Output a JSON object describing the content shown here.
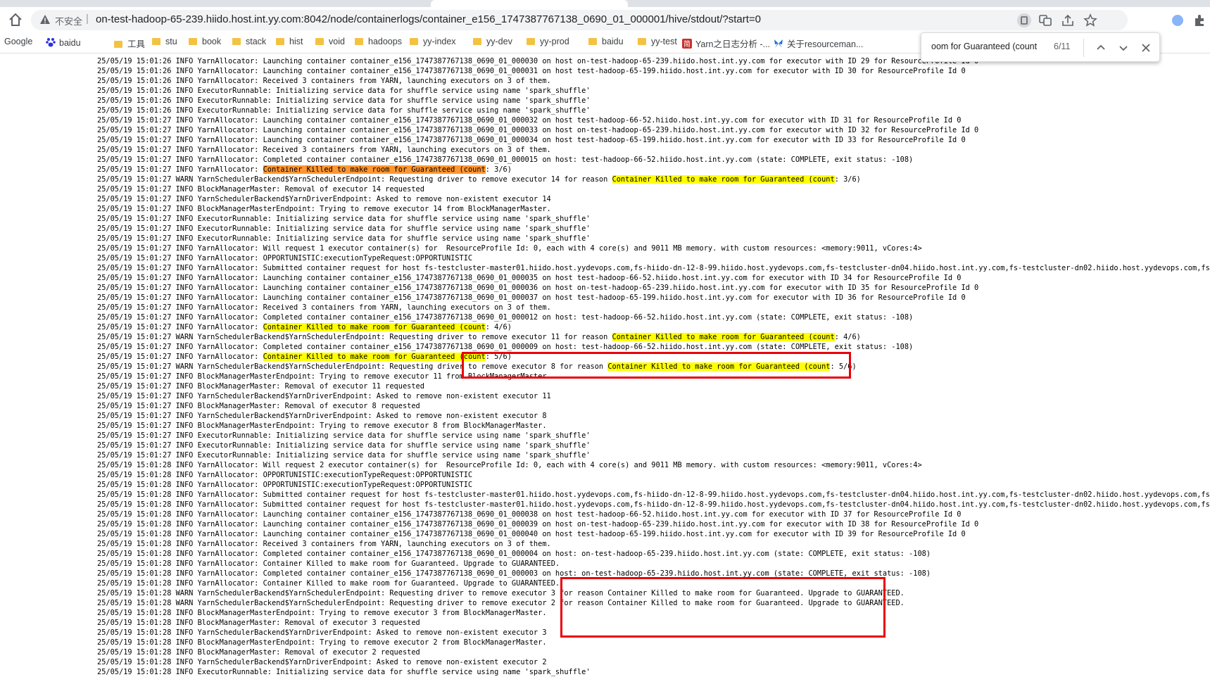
{
  "browser": {
    "insecure_label": "不安全",
    "url": "on-test-hadoop-65-239.hiido.host.int.yy.com:8042/node/containerlogs/container_e156_1747387767138_0690_01_000001/hive/stdout/?start=0",
    "icons": [
      "home-icon",
      "warning-icon",
      "translate-icon",
      "share-icon",
      "star-icon",
      "profile-icon",
      "puzzle-icon"
    ]
  },
  "bookmarks": [
    {
      "label": "Google",
      "icon": "google-icon"
    },
    {
      "label": "baidu",
      "icon": "baidu-paw-icon"
    },
    {
      "label": "工具",
      "icon": "folder-icon"
    },
    {
      "label": "stu",
      "icon": "folder-icon"
    },
    {
      "label": "book",
      "icon": "folder-icon"
    },
    {
      "label": "stack",
      "icon": "folder-icon"
    },
    {
      "label": "hist",
      "icon": "folder-icon"
    },
    {
      "label": "void",
      "icon": "folder-icon"
    },
    {
      "label": "hadoops",
      "icon": "folder-icon"
    },
    {
      "label": "yy-index",
      "icon": "folder-icon"
    },
    {
      "label": "yy-dev",
      "icon": "folder-icon"
    },
    {
      "label": "yy-prod",
      "icon": "folder-icon"
    },
    {
      "label": "baidu",
      "icon": "folder-icon"
    },
    {
      "label": "yy-test",
      "icon": "folder-icon"
    },
    {
      "label": "Yarn之日志分析 -...",
      "icon": "red-bookmark-icon"
    },
    {
      "label": "关于resourceman...",
      "icon": "butterfly-icon"
    }
  ],
  "find": {
    "query": "oom for Guaranteed (count",
    "count": "6/11"
  },
  "colors": {
    "highlight": "#ffff00",
    "current_highlight": "#ff9632",
    "annotation_box": "#e8000b"
  },
  "log_lines": [
    "25/05/19 15:01:26 INFO YarnAllocator: Launching container container_e156_1747387767138_0690_01_000030 on host on-test-hadoop-65-239.hiido.host.int.yy.com for executor with ID 29 for ResourceProfile Id 0",
    "25/05/19 15:01:26 INFO YarnAllocator: Launching container container_e156_1747387767138_0690_01_000031 on host test-hadoop-65-199.hiido.host.int.yy.com for executor with ID 30 for ResourceProfile Id 0",
    "25/05/19 15:01:26 INFO YarnAllocator: Received 3 containers from YARN, launching executors on 3 of them.",
    "25/05/19 15:01:26 INFO ExecutorRunnable: Initializing service data for shuffle service using name 'spark_shuffle'",
    "25/05/19 15:01:26 INFO ExecutorRunnable: Initializing service data for shuffle service using name 'spark_shuffle'",
    "25/05/19 15:01:26 INFO ExecutorRunnable: Initializing service data for shuffle service using name 'spark_shuffle'",
    "25/05/19 15:01:27 INFO YarnAllocator: Launching container container_e156_1747387767138_0690_01_000032 on host test-hadoop-66-52.hiido.host.int.yy.com for executor with ID 31 for ResourceProfile Id 0",
    "25/05/19 15:01:27 INFO YarnAllocator: Launching container container_e156_1747387767138_0690_01_000033 on host on-test-hadoop-65-239.hiido.host.int.yy.com for executor with ID 32 for ResourceProfile Id 0",
    "25/05/19 15:01:27 INFO YarnAllocator: Launching container container_e156_1747387767138_0690_01_000034 on host test-hadoop-65-199.hiido.host.int.yy.com for executor with ID 33 for ResourceProfile Id 0",
    "25/05/19 15:01:27 INFO YarnAllocator: Received 3 containers from YARN, launching executors on 3 of them.",
    "25/05/19 15:01:27 INFO YarnAllocator: Completed container container_e156_1747387767138_0690_01_000015 on host: test-hadoop-66-52.hiido.host.int.yy.com (state: COMPLETE, exit status: -108)",
    "25/05/19 15:01:27 INFO YarnAllocator: [[*Container Killed to make room for Guaranteed (count]]: 3/6)",
    "25/05/19 15:01:27 WARN YarnSchedulerBackend$YarnSchedulerEndpoint: Requesting driver to remove executor 14 for reason [[Container Killed to make room for Guaranteed (count]]: 3/6)",
    "25/05/19 15:01:27 INFO BlockManagerMaster: Removal of executor 14 requested",
    "25/05/19 15:01:27 INFO YarnSchedulerBackend$YarnDriverEndpoint: Asked to remove non-existent executor 14",
    "25/05/19 15:01:27 INFO BlockManagerMasterEndpoint: Trying to remove executor 14 from BlockManagerMaster.",
    "25/05/19 15:01:27 INFO ExecutorRunnable: Initializing service data for shuffle service using name 'spark_shuffle'",
    "25/05/19 15:01:27 INFO ExecutorRunnable: Initializing service data for shuffle service using name 'spark_shuffle'",
    "25/05/19 15:01:27 INFO ExecutorRunnable: Initializing service data for shuffle service using name 'spark_shuffle'",
    "25/05/19 15:01:27 INFO YarnAllocator: Will request 1 executor container(s) for  ResourceProfile Id: 0, each with 4 core(s) and 9011 MB memory. with custom resources: <memory:9011, vCores:4>",
    "25/05/19 15:01:27 INFO YarnAllocator: OPPORTUNISTIC:executionTypeRequest:OPPORTUNISTIC",
    "25/05/19 15:01:27 INFO YarnAllocator: Submitted container request for host fs-testcluster-master01.hiido.host.yydevops.com,fs-hiido-dn-12-8-99.hiido.host.yydevops.com,fs-testcluster-dn04.hiido.host.int.yy.com,fs-testcluster-dn02.hiido.host.yydevops.com,fs-testclu",
    "25/05/19 15:01:27 INFO YarnAllocator: Launching container container_e156_1747387767138_0690_01_000035 on host test-hadoop-66-52.hiido.host.int.yy.com for executor with ID 34 for ResourceProfile Id 0",
    "25/05/19 15:01:27 INFO YarnAllocator: Launching container container_e156_1747387767138_0690_01_000036 on host on-test-hadoop-65-239.hiido.host.int.yy.com for executor with ID 35 for ResourceProfile Id 0",
    "25/05/19 15:01:27 INFO YarnAllocator: Launching container container_e156_1747387767138_0690_01_000037 on host test-hadoop-65-199.hiido.host.int.yy.com for executor with ID 36 for ResourceProfile Id 0",
    "25/05/19 15:01:27 INFO YarnAllocator: Received 3 containers from YARN, launching executors on 3 of them.",
    "25/05/19 15:01:27 INFO YarnAllocator: Completed container container_e156_1747387767138_0690_01_000012 on host: test-hadoop-66-52.hiido.host.int.yy.com (state: COMPLETE, exit status: -108)",
    "25/05/19 15:01:27 INFO YarnAllocator: [[Container Killed to make room for Guaranteed (count]]: 4/6)",
    "25/05/19 15:01:27 WARN YarnSchedulerBackend$YarnSchedulerEndpoint: Requesting driver to remove executor 11 for reason [[Container Killed to make room for Guaranteed (count]]: 4/6)",
    "25/05/19 15:01:27 INFO YarnAllocator: Completed container container_e156_1747387767138_0690_01_000009 on host: test-hadoop-66-52.hiido.host.int.yy.com (state: COMPLETE, exit status: -108)",
    "25/05/19 15:01:27 INFO YarnAllocator: [[Container Killed to make room for Guaranteed (count]]: 5/6)",
    "25/05/19 15:01:27 WARN YarnSchedulerBackend$YarnSchedulerEndpoint: Requesting driver to remove executor 8 for reason [[Container Killed to make room for Guaranteed (count]]: 5/6)",
    "25/05/19 15:01:27 INFO BlockManagerMasterEndpoint: Trying to remove executor 11 from BlockManagerMaster.",
    "25/05/19 15:01:27 INFO BlockManagerMaster: Removal of executor 11 requested",
    "25/05/19 15:01:27 INFO YarnSchedulerBackend$YarnDriverEndpoint: Asked to remove non-existent executor 11",
    "25/05/19 15:01:27 INFO BlockManagerMaster: Removal of executor 8 requested",
    "25/05/19 15:01:27 INFO YarnSchedulerBackend$YarnDriverEndpoint: Asked to remove non-existent executor 8",
    "25/05/19 15:01:27 INFO BlockManagerMasterEndpoint: Trying to remove executor 8 from BlockManagerMaster.",
    "25/05/19 15:01:27 INFO ExecutorRunnable: Initializing service data for shuffle service using name 'spark_shuffle'",
    "25/05/19 15:01:27 INFO ExecutorRunnable: Initializing service data for shuffle service using name 'spark_shuffle'",
    "25/05/19 15:01:27 INFO ExecutorRunnable: Initializing service data for shuffle service using name 'spark_shuffle'",
    "25/05/19 15:01:28 INFO YarnAllocator: Will request 2 executor container(s) for  ResourceProfile Id: 0, each with 4 core(s) and 9011 MB memory. with custom resources: <memory:9011, vCores:4>",
    "25/05/19 15:01:28 INFO YarnAllocator: OPPORTUNISTIC:executionTypeRequest:OPPORTUNISTIC",
    "25/05/19 15:01:28 INFO YarnAllocator: OPPORTUNISTIC:executionTypeRequest:OPPORTUNISTIC",
    "25/05/19 15:01:28 INFO YarnAllocator: Submitted container request for host fs-testcluster-master01.hiido.host.yydevops.com,fs-hiido-dn-12-8-99.hiido.host.yydevops.com,fs-testcluster-dn04.hiido.host.int.yy.com,fs-testcluster-dn02.hiido.host.yydevops.com,fs-testclu",
    "25/05/19 15:01:28 INFO YarnAllocator: Submitted container request for host fs-testcluster-master01.hiido.host.yydevops.com,fs-hiido-dn-12-8-99.hiido.host.yydevops.com,fs-testcluster-dn04.hiido.host.int.yy.com,fs-testcluster-dn02.hiido.host.yydevops.com,fs-testclu",
    "25/05/19 15:01:28 INFO YarnAllocator: Launching container container_e156_1747387767138_0690_01_000038 on host test-hadoop-66-52.hiido.host.int.yy.com for executor with ID 37 for ResourceProfile Id 0",
    "25/05/19 15:01:28 INFO YarnAllocator: Launching container container_e156_1747387767138_0690_01_000039 on host on-test-hadoop-65-239.hiido.host.int.yy.com for executor with ID 38 for ResourceProfile Id 0",
    "25/05/19 15:01:28 INFO YarnAllocator: Launching container container_e156_1747387767138_0690_01_000040 on host test-hadoop-65-199.hiido.host.int.yy.com for executor with ID 39 for ResourceProfile Id 0",
    "25/05/19 15:01:28 INFO YarnAllocator: Received 3 containers from YARN, launching executors on 3 of them.",
    "25/05/19 15:01:28 INFO YarnAllocator: Completed container container_e156_1747387767138_0690_01_000004 on host: on-test-hadoop-65-239.hiido.host.int.yy.com (state: COMPLETE, exit status: -108)",
    "25/05/19 15:01:28 INFO YarnAllocator: Container Killed to make room for Guaranteed. Upgrade to GUARANTEED.",
    "25/05/19 15:01:28 INFO YarnAllocator: Completed container container_e156_1747387767138_0690_01_000003 on host: on-test-hadoop-65-239.hiido.host.int.yy.com (state: COMPLETE, exit status: -108)",
    "25/05/19 15:01:28 INFO YarnAllocator: Container Killed to make room for Guaranteed. Upgrade to GUARANTEED.",
    "25/05/19 15:01:28 WARN YarnSchedulerBackend$YarnSchedulerEndpoint: Requesting driver to remove executor 3 for reason Container Killed to make room for Guaranteed. Upgrade to GUARANTEED.",
    "25/05/19 15:01:28 WARN YarnSchedulerBackend$YarnSchedulerEndpoint: Requesting driver to remove executor 2 for reason Container Killed to make room for Guaranteed. Upgrade to GUARANTEED.",
    "25/05/19 15:01:28 INFO BlockManagerMasterEndpoint: Trying to remove executor 3 from BlockManagerMaster.",
    "25/05/19 15:01:28 INFO BlockManagerMaster: Removal of executor 3 requested",
    "25/05/19 15:01:28 INFO YarnSchedulerBackend$YarnDriverEndpoint: Asked to remove non-existent executor 3",
    "25/05/19 15:01:28 INFO BlockManagerMasterEndpoint: Trying to remove executor 2 from BlockManagerMaster.",
    "25/05/19 15:01:28 INFO BlockManagerMaster: Removal of executor 2 requested",
    "25/05/19 15:01:28 INFO YarnSchedulerBackend$YarnDriverEndpoint: Asked to remove non-existent executor 2",
    "25/05/19 15:01:28 INFO ExecutorRunnable: Initializing service data for shuffle service using name 'spark_shuffle'"
  ]
}
